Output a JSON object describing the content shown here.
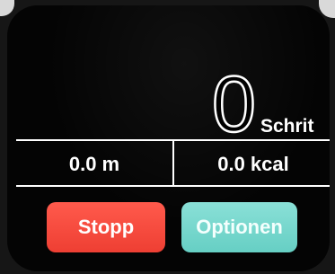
{
  "steps": {
    "value": "0",
    "unit": "Schrit"
  },
  "stats": {
    "distance": "0.0 m",
    "calories": "0.0 kcal"
  },
  "buttons": {
    "stop_label": "Stopp",
    "options_label": "Optionen"
  },
  "colors": {
    "background": "#040404",
    "text": "#ffffff",
    "stop_button": "#f0463a",
    "options_button": "#78d8ce"
  }
}
